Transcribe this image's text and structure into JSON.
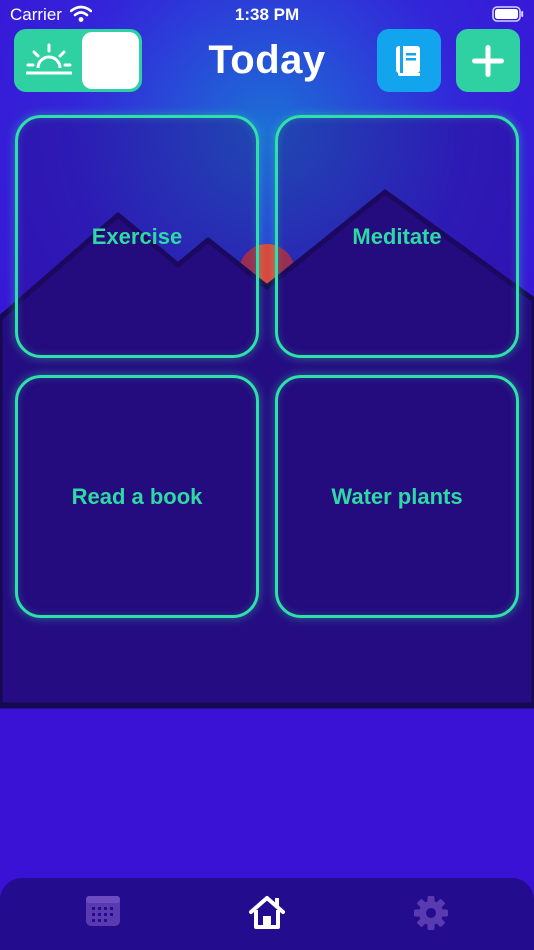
{
  "status_bar": {
    "carrier": "Carrier",
    "time": "1:38 PM"
  },
  "header": {
    "title": "Today",
    "theme_toggle_icon": "sunrise-icon",
    "journal_icon": "book-icon",
    "add_icon": "plus-icon"
  },
  "habits": [
    {
      "label": "Exercise"
    },
    {
      "label": "Meditate"
    },
    {
      "label": "Read a book"
    },
    {
      "label": "Water plants"
    }
  ],
  "tab_bar": {
    "items": [
      {
        "icon": "calendar-icon",
        "active": false
      },
      {
        "icon": "home-icon",
        "active": true
      },
      {
        "icon": "gear-icon",
        "active": false
      }
    ]
  },
  "colors": {
    "accent_green": "#2fd1a2",
    "accent_blue": "#12a5ee",
    "sky": "#3a12d6",
    "mountain": "#250c82",
    "sun": "#e0453a"
  }
}
